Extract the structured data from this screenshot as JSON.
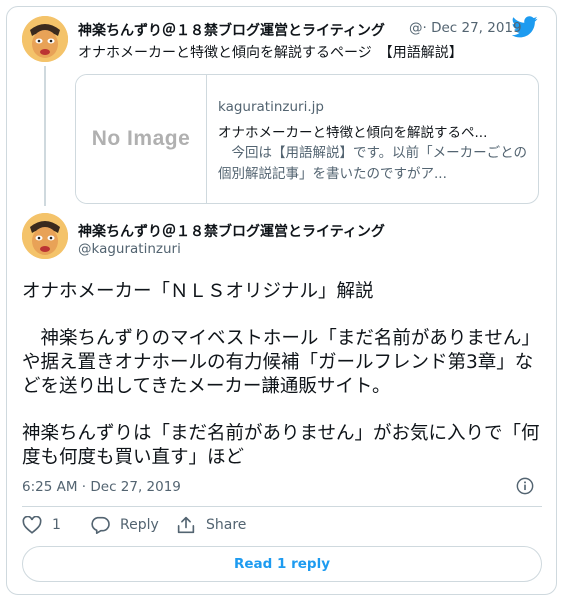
{
  "quoted": {
    "name": "神楽ちんずり＠１８禁ブログ運営とライティング",
    "meta": "@· Dec 27, 2019",
    "text": "オナホメーカーと特徴と傾向を解説するページ　【用語解説】",
    "link": {
      "image_text": "No Image",
      "domain": "kaguratinzuri.jp",
      "title": "オナホメーカーと特徴と傾向を解説するペ...",
      "description": "　今回は【用語解説】です。以前「メーカーごとの個別解説記事」を書いたのですがア..."
    }
  },
  "tweet": {
    "name": "神楽ちんずり＠１８禁ブログ運営とライティング",
    "handle": "@kaguratinzuri",
    "lines": [
      "オナホメーカー「ＮＬＳオリジナル」解説",
      "",
      "　神楽ちんずりのマイベストホール「まだ名前がありません」や据え置きオナホールの有力候補「ガールフレンド第3章」などを送り出してきたメーカー謙通販サイト。",
      "",
      "神楽ちんずりは「まだ名前がありません」がお気に入りで「何度も何度も買い直す」ほど"
    ],
    "timestamp": "6:25 AM · Dec 27, 2019"
  },
  "actions": {
    "like_count": "1",
    "reply_label": "Reply",
    "share_label": "Share"
  },
  "read_replies_label": "Read 1 reply",
  "colors": {
    "accent": "#1d9bf0",
    "muted": "#536471",
    "border": "#cfd9de"
  },
  "icons": [
    "twitter-bird-icon",
    "heart-icon",
    "reply-bubble-icon",
    "share-icon",
    "info-icon"
  ]
}
